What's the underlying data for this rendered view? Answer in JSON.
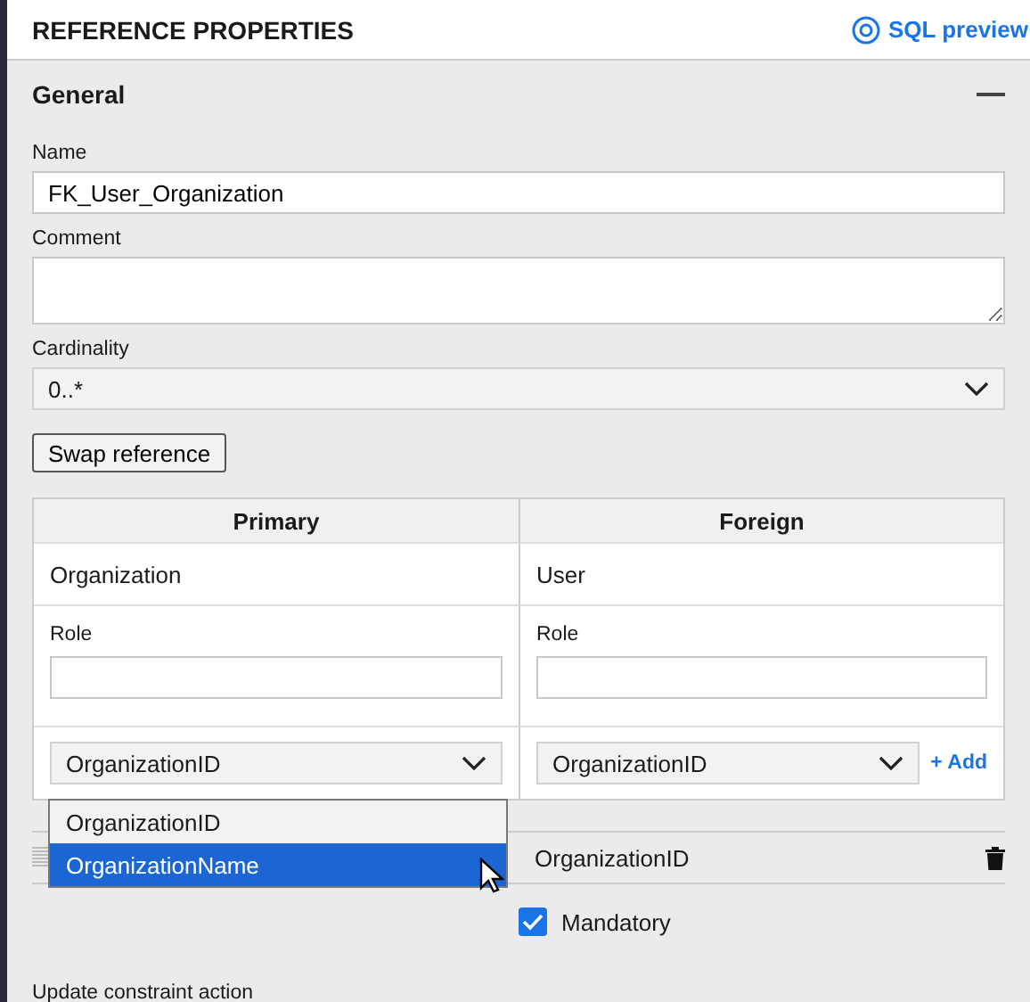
{
  "header": {
    "title": "REFERENCE PROPERTIES",
    "link": "SQL preview"
  },
  "section": {
    "title": "General",
    "expanded": true
  },
  "fields": [
    {
      "kind": "text",
      "label": "Name",
      "value": "FK_User_Organization"
    },
    {
      "kind": "textarea",
      "label": "Comment"
    },
    {
      "kind": "select",
      "label": "Cardinality",
      "value": "0..*"
    }
  ],
  "swap_button": "Swap reference",
  "table": {
    "columns": [
      {
        "heading": "Primary",
        "entity": "Organization",
        "role_label": "Role",
        "key": "OrganizationID"
      },
      {
        "heading": "Foreign",
        "entity": "User",
        "role_label": "Role",
        "key": "OrganizationID",
        "add_link": "+ Add"
      }
    ]
  },
  "dropdown_options": [
    {
      "label": "OrganizationID",
      "selected": false
    },
    {
      "label": "OrganizationName",
      "selected": true
    }
  ],
  "mapping_row": {
    "foreign_key": "OrganizationID"
  },
  "mandatory": {
    "label": "Mandatory",
    "checked": true
  },
  "next_section_label": "Update constraint action"
}
